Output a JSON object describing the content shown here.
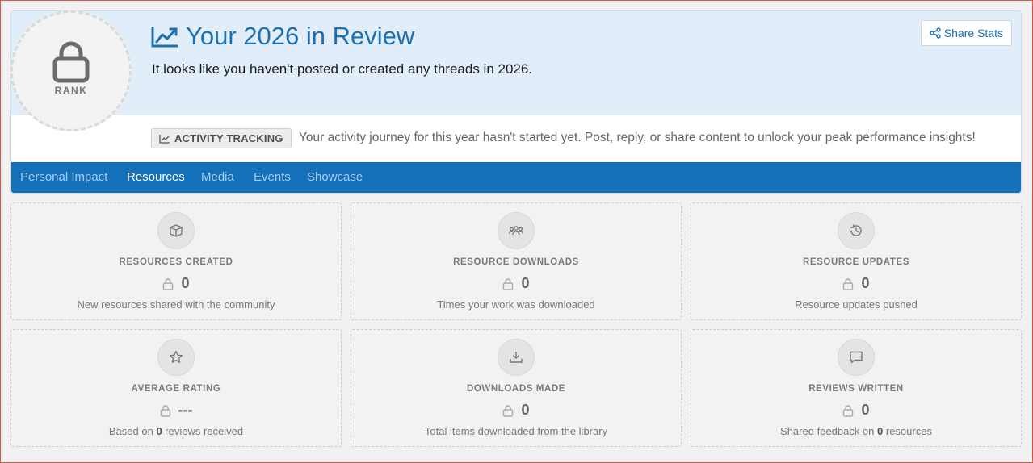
{
  "header": {
    "title": "Your 2026 in Review",
    "subtitle": "It looks like you haven't posted or created any threads in 2026.",
    "share_label": "Share Stats",
    "rank_label": "RANK"
  },
  "banner": {
    "badge": "ACTIVITY TRACKING",
    "text": "Your activity journey for this year hasn't started yet. Post, reply, or share content to unlock your peak performance insights!"
  },
  "tabs": [
    {
      "label": "Personal Impact",
      "active": false
    },
    {
      "label": "Resources",
      "active": true
    },
    {
      "label": "Media",
      "active": false
    },
    {
      "label": "Events",
      "active": false
    },
    {
      "label": "Showcase",
      "active": false
    }
  ],
  "stats": [
    {
      "icon": "box-icon",
      "label": "RESOURCES CREATED",
      "value": "0",
      "desc": "New resources shared with the community"
    },
    {
      "icon": "users-icon",
      "label": "RESOURCE DOWNLOADS",
      "value": "0",
      "desc": "Times your work was downloaded"
    },
    {
      "icon": "history-icon",
      "label": "RESOURCE UPDATES",
      "value": "0",
      "desc": "Resource updates pushed"
    },
    {
      "icon": "star-icon",
      "label": "AVERAGE RATING",
      "value": "---",
      "desc_pre": "Based on ",
      "desc_bold": "0",
      "desc_post": " reviews received"
    },
    {
      "icon": "download-icon",
      "label": "DOWNLOADS MADE",
      "value": "0",
      "desc": "Total items downloaded from the library"
    },
    {
      "icon": "comment-icon",
      "label": "REVIEWS WRITTEN",
      "value": "0",
      "desc_pre": "Shared feedback on ",
      "desc_bold": "0",
      "desc_post": " resources"
    }
  ],
  "colors": {
    "accent": "#1d6fb4",
    "tab_bar": "#1470b8",
    "hero_bg": "#e1edf8"
  }
}
